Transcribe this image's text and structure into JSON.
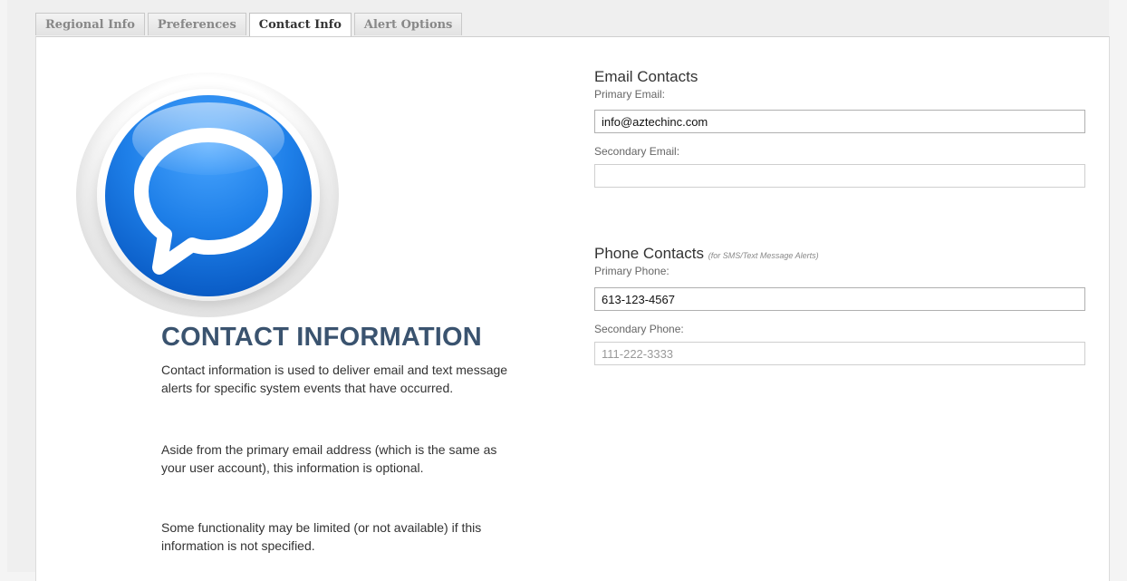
{
  "tabs": [
    {
      "label": "Regional Info",
      "active": false
    },
    {
      "label": "Preferences",
      "active": false
    },
    {
      "label": "Contact Info",
      "active": true
    },
    {
      "label": "Alert Options",
      "active": false
    }
  ],
  "icon": {
    "name": "speech-bubble-icon",
    "colors": {
      "ball": "#1e7fe8",
      "bubble": "#ffffff"
    }
  },
  "left": {
    "title": "CONTACT INFORMATION",
    "paragraphs": [
      "Contact information is used to deliver email and text message alerts for specific system events that have occurred.",
      "Aside from the primary email address (which is the same as your user account), this information is optional.",
      "Some functionality may be limited (or not available) if this information is not specified."
    ]
  },
  "email": {
    "title": "Email Contacts",
    "primary_label": "Primary Email:",
    "primary_value": "info@aztechinc.com",
    "secondary_label": "Secondary Email:",
    "secondary_value": ""
  },
  "phone": {
    "title": "Phone Contacts",
    "note": "(for SMS/Text Message Alerts)",
    "primary_label": "Primary Phone:",
    "primary_value": "613-123-4567",
    "secondary_label": "Secondary Phone:",
    "secondary_placeholder": "111-222-3333"
  }
}
